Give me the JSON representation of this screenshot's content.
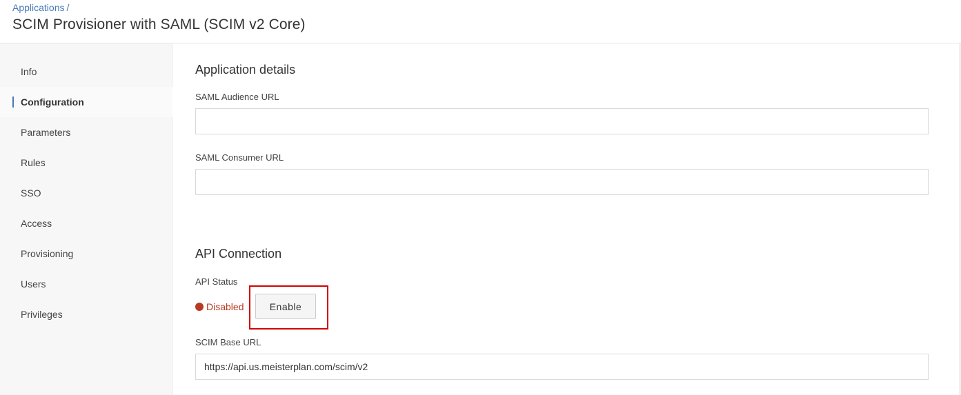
{
  "header": {
    "breadcrumb": "Applications",
    "breadcrumb_sep": "/",
    "title": "SCIM Provisioner with SAML (SCIM v2 Core)"
  },
  "sidebar": {
    "items": [
      {
        "label": "Info"
      },
      {
        "label": "Configuration",
        "active": true
      },
      {
        "label": "Parameters"
      },
      {
        "label": "Rules"
      },
      {
        "label": "SSO"
      },
      {
        "label": "Access"
      },
      {
        "label": "Provisioning"
      },
      {
        "label": "Users"
      },
      {
        "label": "Privileges"
      }
    ]
  },
  "main": {
    "application_details": {
      "title": "Application details",
      "saml_audience_url": {
        "label": "SAML Audience URL",
        "value": ""
      },
      "saml_consumer_url": {
        "label": "SAML Consumer URL",
        "value": ""
      }
    },
    "api_connection": {
      "title": "API Connection",
      "status_label": "API Status",
      "status_value": "Disabled",
      "status_color": "#b83a22",
      "enable_button_label": "Enable",
      "scim_base_url": {
        "label": "SCIM Base URL",
        "value": "https://api.us.meisterplan.com/scim/v2"
      }
    }
  },
  "colors": {
    "accent": "#4a7ab8",
    "highlight": "#d40000"
  }
}
